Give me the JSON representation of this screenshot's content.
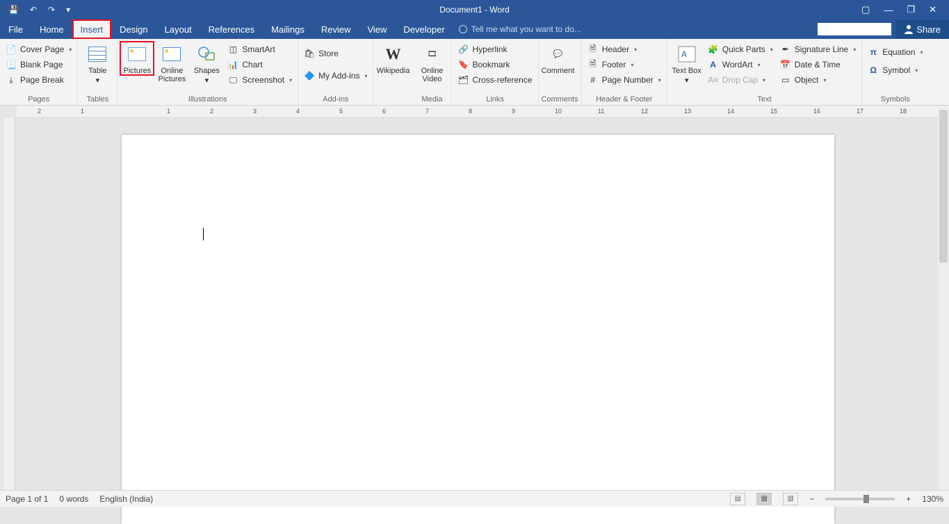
{
  "title": "Document1 - Word",
  "qat": {
    "save": "💾",
    "undo": "↶",
    "redo": "↷",
    "more": "▾"
  },
  "winctrl": {
    "ribbon_opts": "▢",
    "min": "—",
    "max": "❐",
    "close": "✕"
  },
  "tabs": [
    "File",
    "Home",
    "Insert",
    "Design",
    "Layout",
    "References",
    "Mailings",
    "Review",
    "View",
    "Developer"
  ],
  "active_tab": "Insert",
  "tellme": "Tell me what you want to do...",
  "share": "Share",
  "ribbon": {
    "pages": {
      "label": "Pages",
      "cover": "Cover Page",
      "blank": "Blank Page",
      "break": "Page Break"
    },
    "tables": {
      "label": "Tables",
      "table": "Table"
    },
    "illus": {
      "label": "Illustrations",
      "pictures": "Pictures",
      "online": "Online Pictures",
      "shapes": "Shapes",
      "smartart": "SmartArt",
      "chart": "Chart",
      "screenshot": "Screenshot"
    },
    "addins": {
      "label": "Add-ins",
      "store": "Store",
      "myaddins": "My Add-ins"
    },
    "media_wiki": "Wikipedia",
    "media": {
      "label": "Media",
      "onlinevideo": "Online Video"
    },
    "links": {
      "label": "Links",
      "hyperlink": "Hyperlink",
      "bookmark": "Bookmark",
      "crossref": "Cross-reference"
    },
    "comments": {
      "label": "Comments",
      "comment": "Comment"
    },
    "hf": {
      "label": "Header & Footer",
      "header": "Header",
      "footer": "Footer",
      "pagenum": "Page Number"
    },
    "text": {
      "label": "Text",
      "textbox": "Text Box",
      "quickparts": "Quick Parts",
      "wordart": "WordArt",
      "dropcap": "Drop Cap",
      "sigline": "Signature Line",
      "datetime": "Date & Time",
      "object": "Object"
    },
    "symbols": {
      "label": "Symbols",
      "equation": "Equation",
      "symbol": "Symbol"
    }
  },
  "ruler_nums": [
    "2",
    "1",
    "",
    "1",
    "2",
    "3",
    "4",
    "5",
    "6",
    "7",
    "8",
    "9",
    "10",
    "11",
    "12",
    "13",
    "14",
    "15",
    "16",
    "17",
    "18"
  ],
  "status": {
    "page": "Page 1 of 1",
    "words": "0 words",
    "lang": "English (India)",
    "zoom": "130%"
  }
}
